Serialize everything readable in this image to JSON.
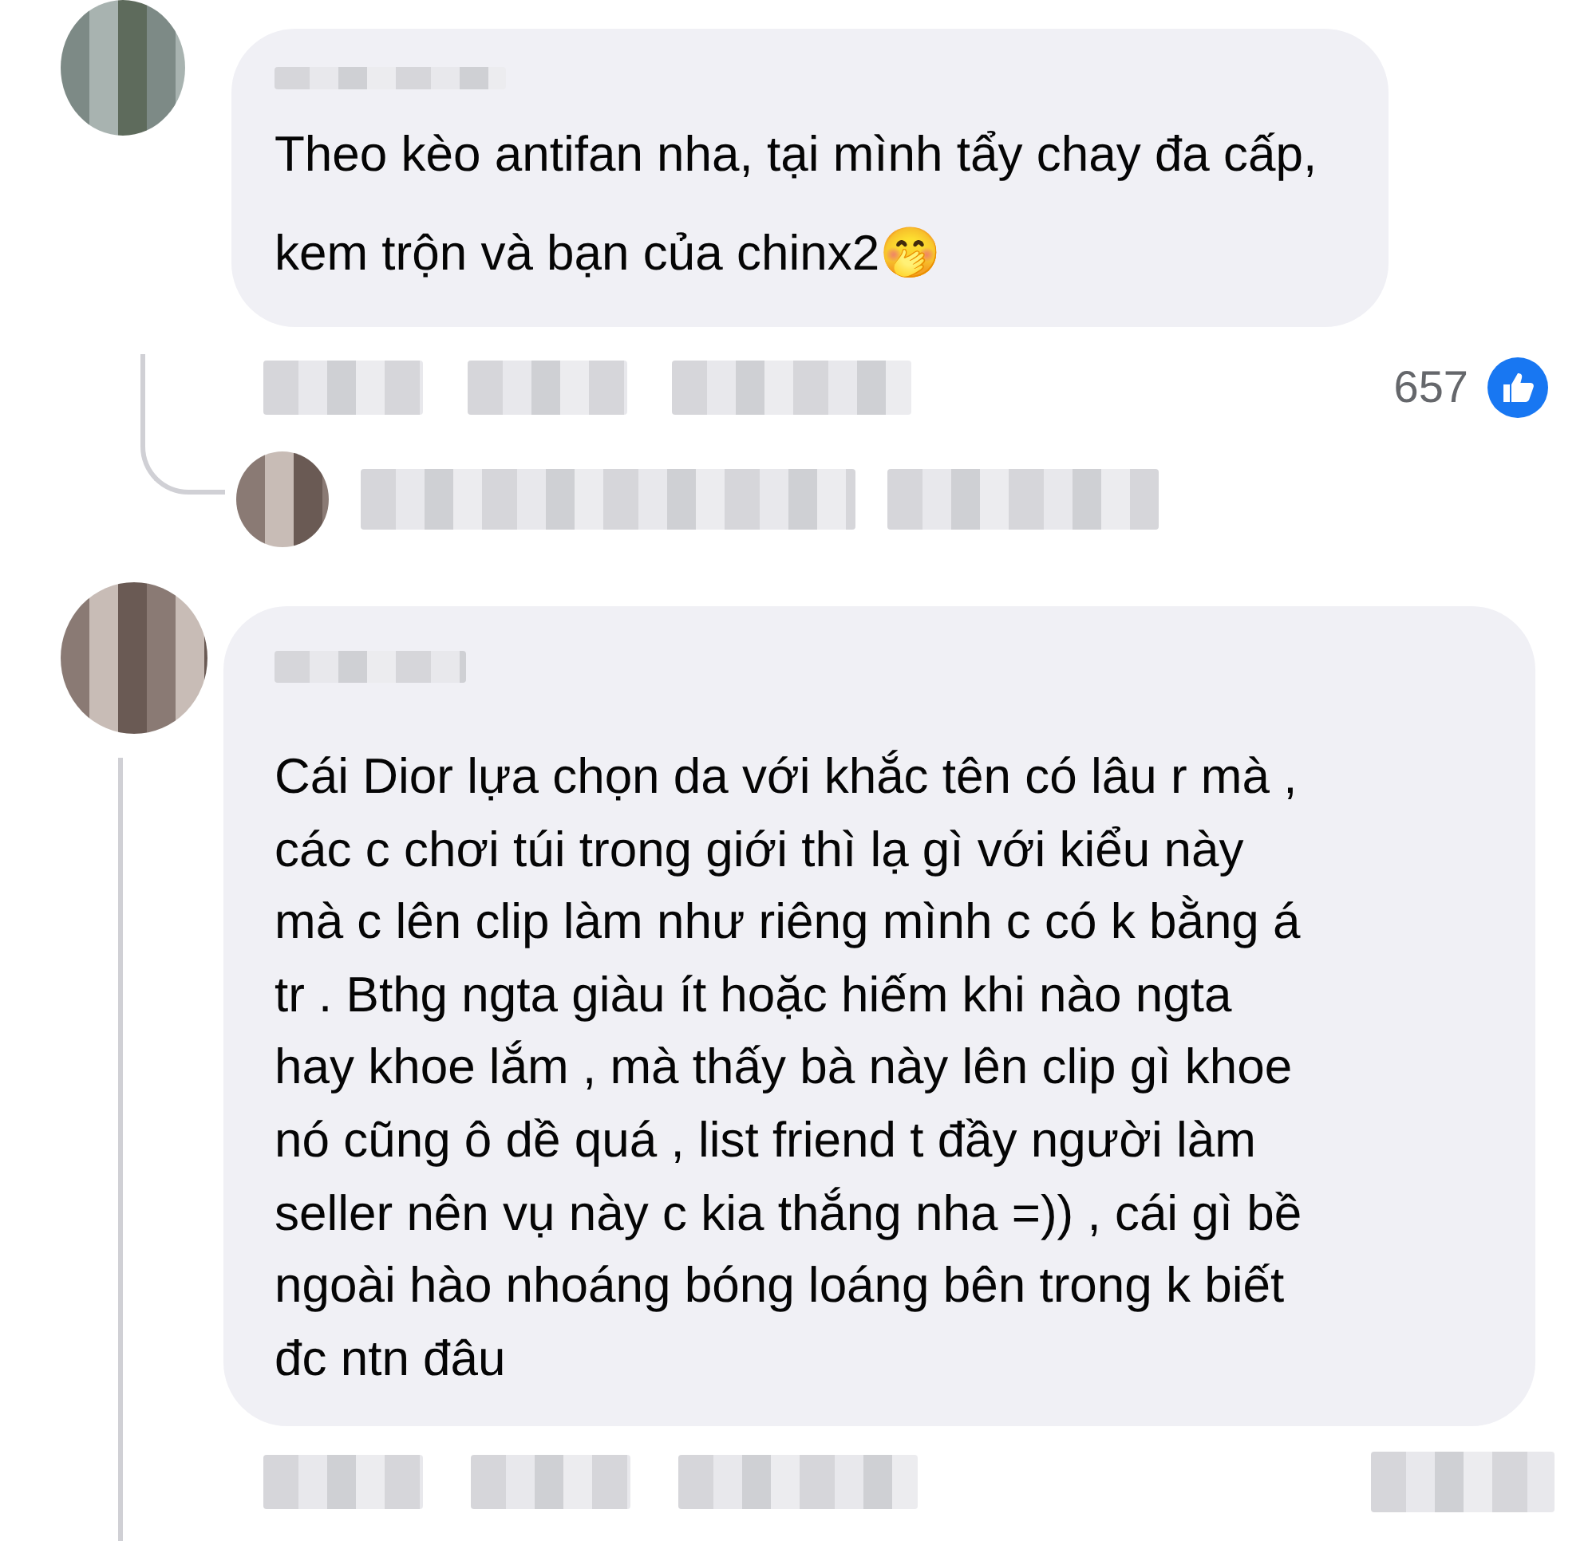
{
  "comments": [
    {
      "text": "Theo kèo antifan nha, tại mình tẩy chay đa cấp, kem trộn và bạn của chinx2🤭",
      "reaction_count": "657"
    },
    {
      "lines": [
        "Cái Dior lựa chọn da với khắc tên có lâu r mà ,",
        "các c chơi túi trong giới thì lạ gì với kiểu này",
        "mà c lên clip làm như riêng mình c có k bằng á",
        "tr . Bthg ngta giàu ít hoặc hiếm khi nào ngta",
        "hay khoe lắm , mà thấy bà này lên clip gì khoe",
        "nó cũng ô dề quá , list friend t đầy người làm",
        "seller nên vụ này c kia thắng nha =)) , cái gì bề",
        "ngoài hào nhoáng bóng loáng bên trong k biết",
        "đc ntn đâu"
      ]
    }
  ]
}
